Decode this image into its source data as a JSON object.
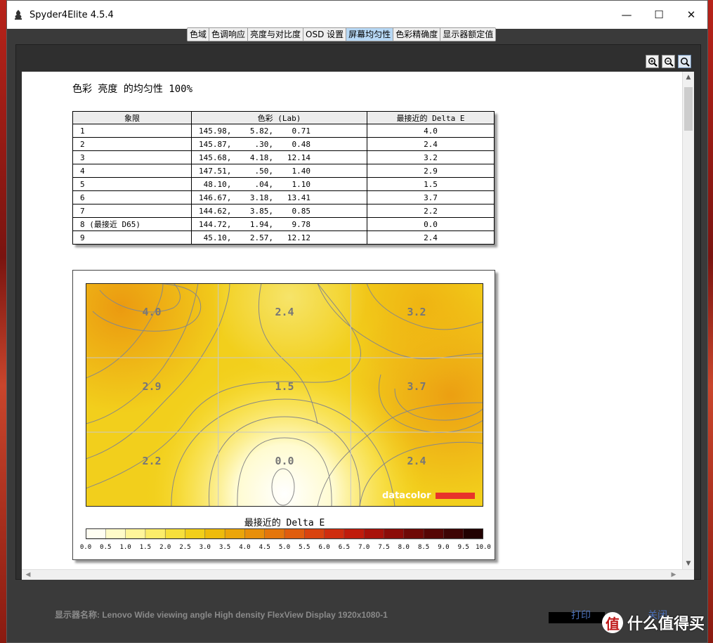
{
  "window": {
    "title": "Spyder4Elite 4.5.4",
    "controls": {
      "minimize": "—",
      "maximize": "☐",
      "close": "✕"
    }
  },
  "tabs": [
    {
      "label": "色域",
      "active": false
    },
    {
      "label": "色调响应",
      "active": false
    },
    {
      "label": "亮度与对比度",
      "active": false
    },
    {
      "label": "OSD 设置",
      "active": false
    },
    {
      "label": "屏幕均匀性",
      "active": true
    },
    {
      "label": "色彩精确度",
      "active": false
    },
    {
      "label": "显示器额定值",
      "active": false
    }
  ],
  "zoom_tools": [
    "zoom-in-icon",
    "zoom-out-icon",
    "zoom-fit-icon"
  ],
  "report": {
    "title": "色彩 亮度 的均匀性 100%",
    "table": {
      "headers": [
        "象限",
        "色彩 (Lab)",
        "最接近的 Delta E"
      ],
      "rows": [
        {
          "quadrant": "1",
          "lab": "145.98,    5.82,    0.71",
          "delta": "4.0"
        },
        {
          "quadrant": "2",
          "lab": "145.87,     .30,    0.48",
          "delta": "2.4"
        },
        {
          "quadrant": "3",
          "lab": "145.68,    4.18,   12.14",
          "delta": "3.2"
        },
        {
          "quadrant": "4",
          "lab": "147.51,     .50,    1.40",
          "delta": "2.9"
        },
        {
          "quadrant": "5",
          "lab": " 48.10,     .04,    1.10",
          "delta": "1.5"
        },
        {
          "quadrant": "6",
          "lab": "146.67,    3.18,   13.41",
          "delta": "3.7"
        },
        {
          "quadrant": "7",
          "lab": "144.62,    3.85,    0.85",
          "delta": "2.2"
        },
        {
          "quadrant": "8 (最接近 D65)",
          "lab": "144.72,    1.94,    9.78",
          "delta": "0.0"
        },
        {
          "quadrant": "9",
          "lab": " 45.10,    2.57,   12.12",
          "delta": "2.4"
        }
      ]
    },
    "map": {
      "grid_values": [
        "4.0",
        "2.4",
        "3.2",
        "2.9",
        "1.5",
        "3.7",
        "2.2",
        "0.0",
        "2.4"
      ],
      "brand": "datacolor",
      "brand_bar_color": "#e8332a"
    },
    "legend": {
      "title": "最接近的 Delta E",
      "ticks": [
        "0.0",
        "0.5",
        "1.0",
        "1.5",
        "2.0",
        "2.5",
        "3.0",
        "3.5",
        "4.0",
        "4.5",
        "5.0",
        "5.5",
        "6.0",
        "6.5",
        "7.0",
        "7.5",
        "8.0",
        "8.5",
        "9.0",
        "9.5",
        "10.0"
      ],
      "colors": [
        "#fffef2",
        "#fffbc8",
        "#fff59a",
        "#fbec6a",
        "#f6df3c",
        "#f2cf1a",
        "#eebb0c",
        "#eba50a",
        "#e88f0a",
        "#e4760c",
        "#e05d0e",
        "#d9430f",
        "#cf2d0f",
        "#c01c0c",
        "#a8120a",
        "#8c0c08",
        "#6f0906",
        "#560605",
        "#3e0404",
        "#220202"
      ]
    }
  },
  "footer": {
    "display_name_label": "显示器名称:",
    "display_name": "Lenovo Wide viewing angle  High density FlexView Display 1920x1080-1",
    "print_label": "打印",
    "close_label": "关闭",
    "watermark_text": "什么值得买",
    "watermark_glyph": "值"
  }
}
